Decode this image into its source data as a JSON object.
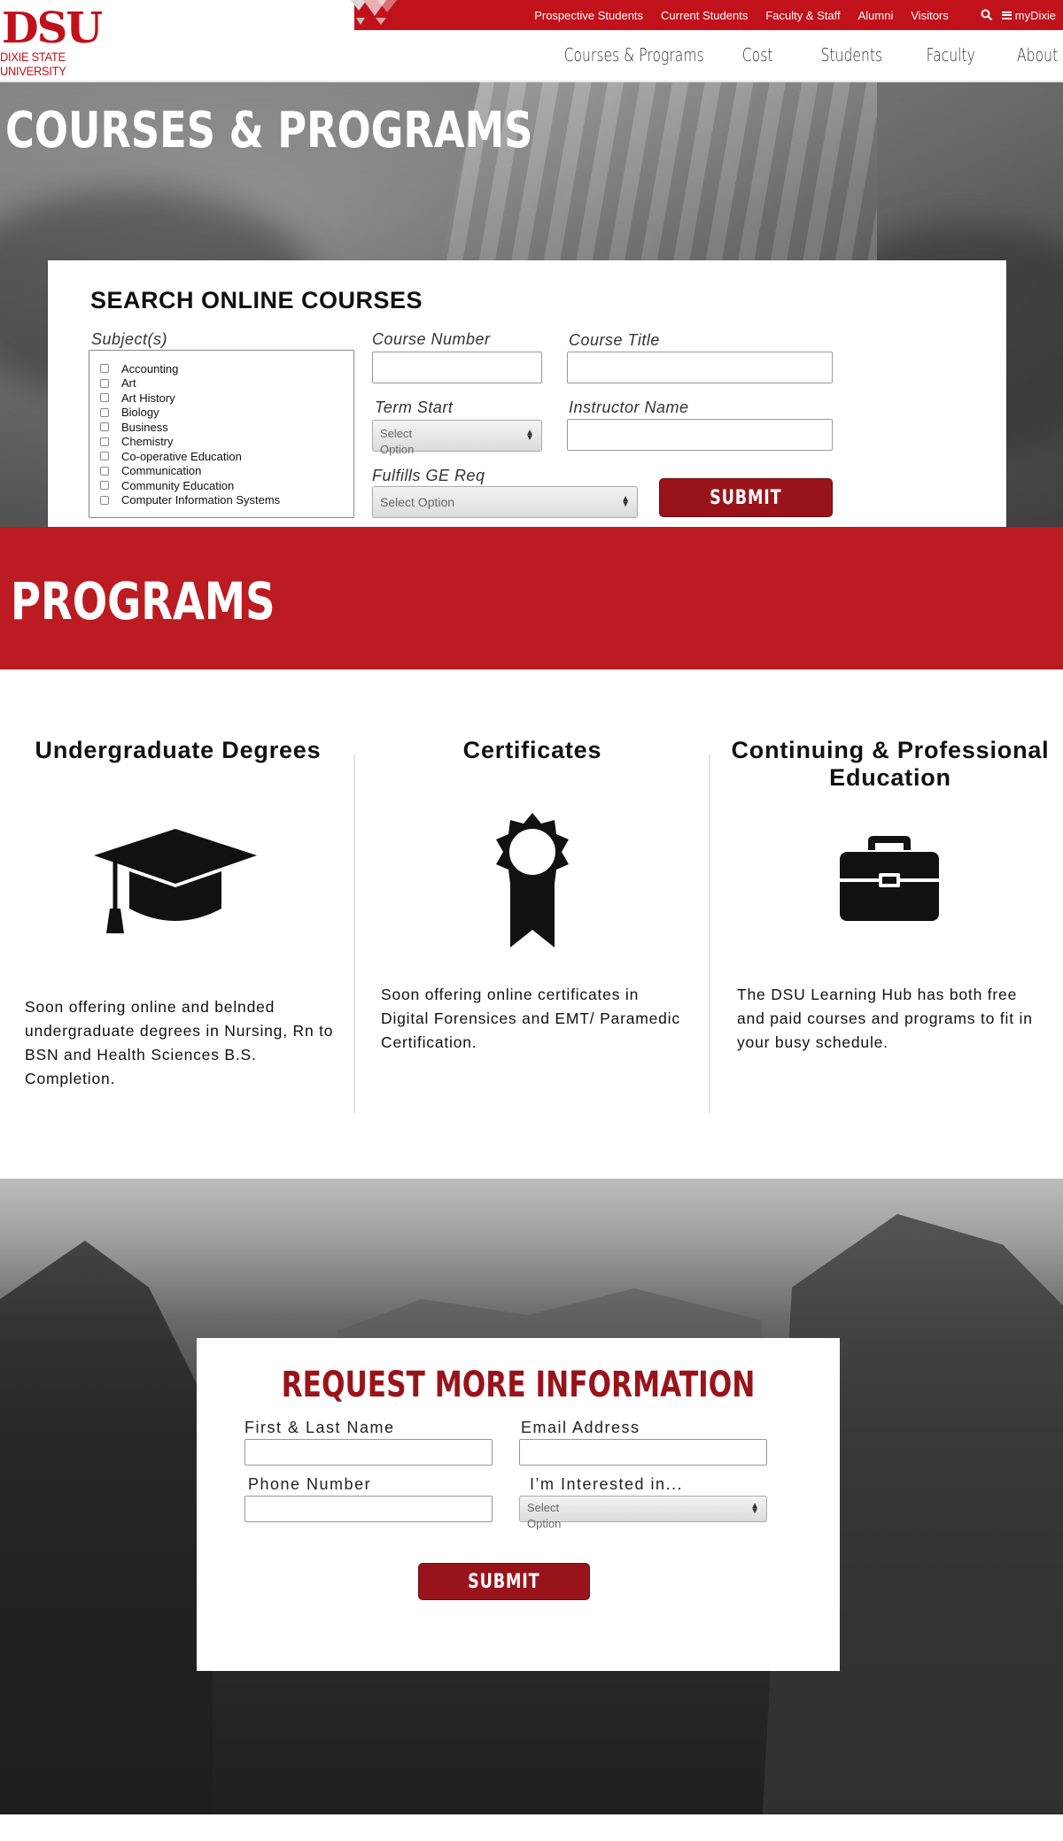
{
  "utility_nav": {
    "items": [
      "Prospective Students",
      "Current Students",
      "Faculty & Staff",
      "Alumni",
      "Visitors"
    ],
    "mydixie_label": "myDixie"
  },
  "logo": {
    "mark": "DSU",
    "name": "DIXIE STATE UNIVERSITY"
  },
  "main_nav": {
    "items": [
      "Courses & Programs",
      "Cost",
      "Students",
      "Faculty",
      "About"
    ]
  },
  "hero": {
    "title": "COURSES & PROGRAMS"
  },
  "search": {
    "heading": "SEARCH ONLINE COURSES",
    "subjects_label": "Subject(s)",
    "subjects": [
      "Accounting",
      "Art",
      "Art History",
      "Biology",
      "Business",
      "Chemistry",
      "Co-operative Education",
      "Communication",
      "Community Education",
      "Computer Information Systems"
    ],
    "course_number_label": "Course Number",
    "course_title_label": "Course Title",
    "term_start_label": "Term Start",
    "term_start_value": "Select Option",
    "instructor_label": "Instructor Name",
    "ge_label": "Fulfills GE Req",
    "ge_value": "Select Option",
    "submit_label": "SUBMIT"
  },
  "programs": {
    "heading": "PROGRAMS",
    "columns": [
      {
        "title": "Undergraduate Degrees",
        "icon": "graduation-cap-icon",
        "text": "Soon offering online and belnded undergraduate degrees in Nursing, Rn to BSN and Health Sciences B.S. Completion."
      },
      {
        "title": "Certificates",
        "icon": "award-ribbon-icon",
        "text": "Soon offering online certificates in Digital Forensices and EMT/ Paramedic Certification."
      },
      {
        "title": "Continuing & Professional Education",
        "icon": "briefcase-icon",
        "text": "The DSU Learning Hub has both free and paid courses and programs to fit in your busy schedule."
      }
    ]
  },
  "request_info": {
    "heading": "REQUEST MORE INFORMATION",
    "name_label": "First & Last Name",
    "email_label": "Email Address",
    "phone_label": "Phone Number",
    "interest_label": "I’m Interested in...",
    "interest_value": "Select Option",
    "submit_label": "SUBMIT"
  },
  "colors": {
    "brand_red": "#c1111b",
    "dark_red": "#98141a",
    "banner_red": "#bd1b22"
  }
}
